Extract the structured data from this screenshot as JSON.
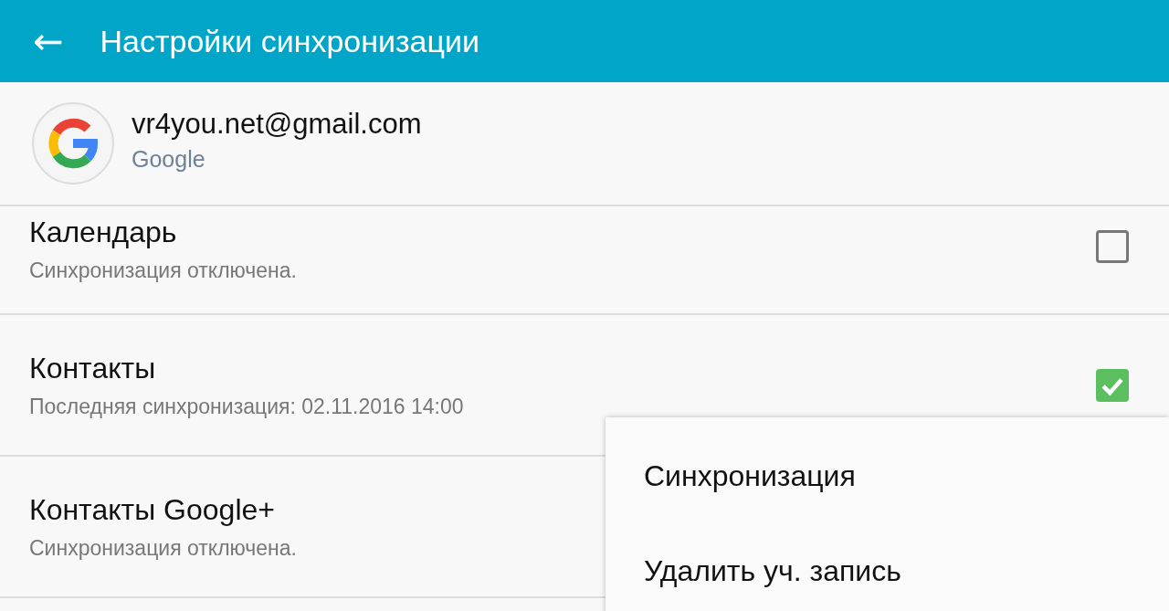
{
  "app_bar": {
    "back_icon": "←",
    "title": "Настройки синхронизации"
  },
  "account": {
    "email": "vr4you.net@gmail.com",
    "type": "Google"
  },
  "sync_items": [
    {
      "title": "Календарь",
      "subtitle": "Синхронизация отключена.",
      "checked": false
    },
    {
      "title": "Контакты",
      "subtitle": "Последняя синхронизация: 02.11.2016 14:00",
      "checked": true
    },
    {
      "title": "Контакты Google+",
      "subtitle": "Синхронизация отключена."
    }
  ],
  "menu": {
    "items": [
      "Синхронизация",
      "Удалить уч. запись"
    ]
  }
}
